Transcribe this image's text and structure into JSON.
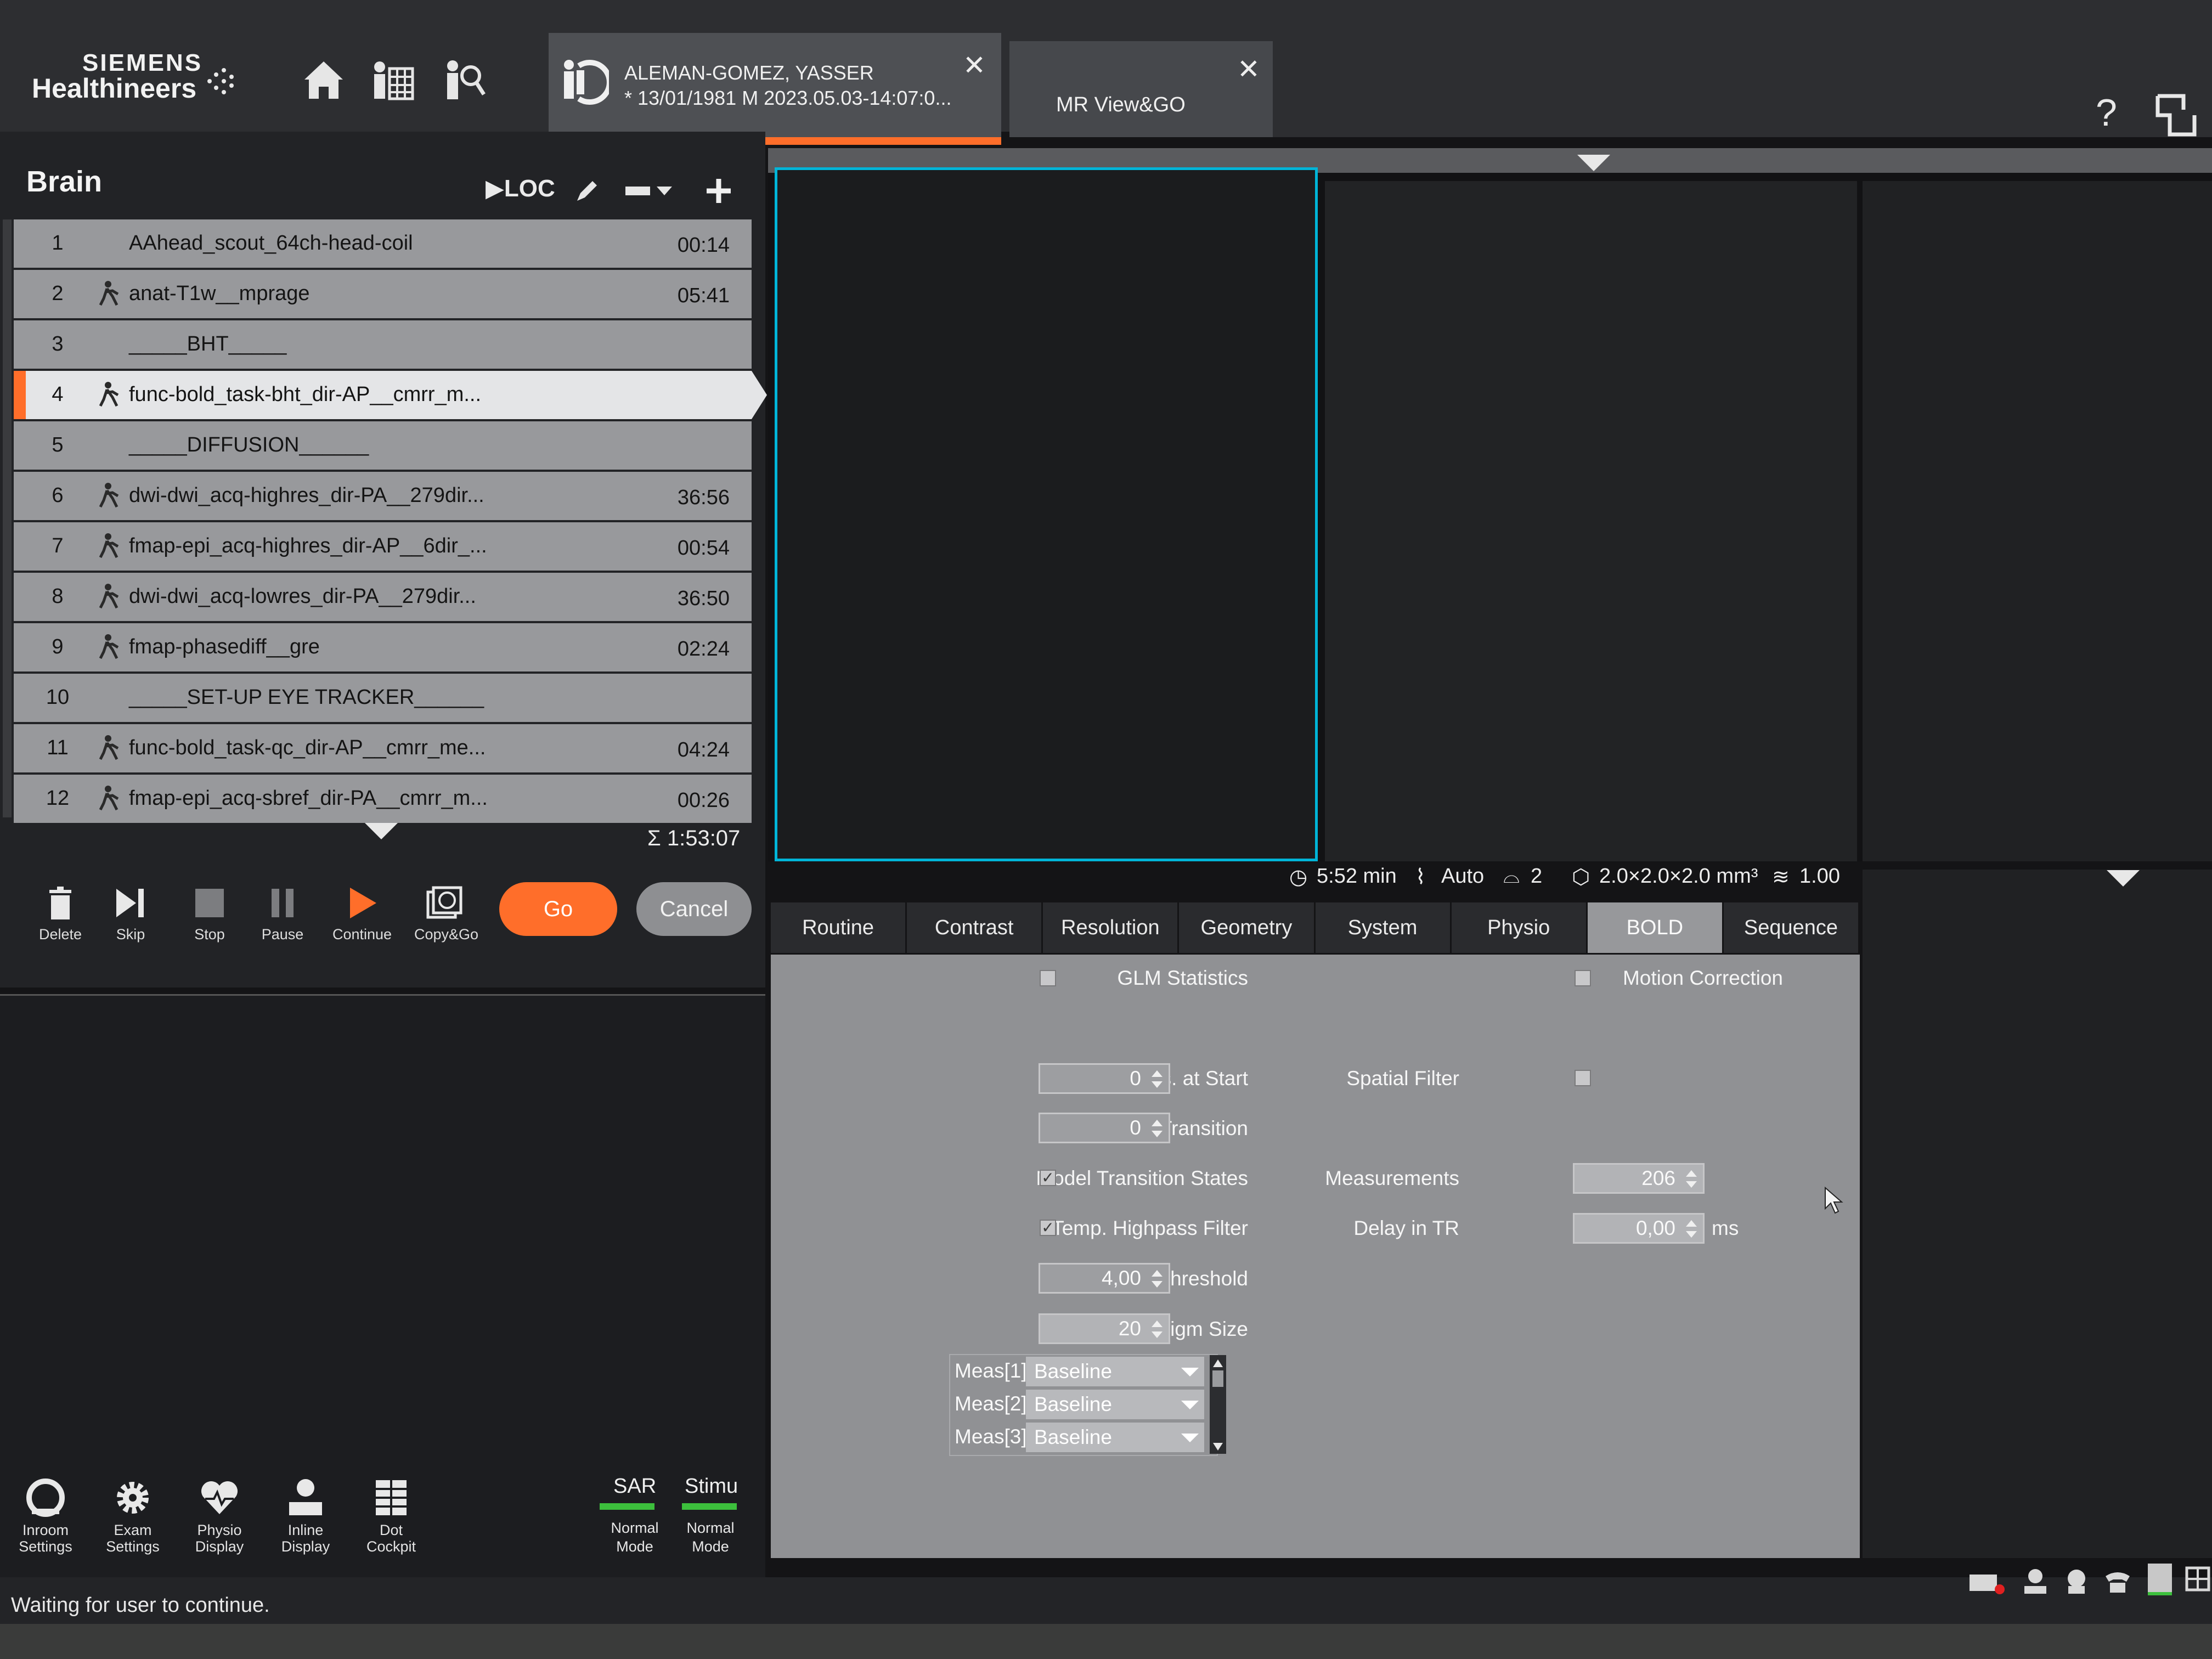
{
  "brand": {
    "line1": "SIEMENS",
    "line2": "Healthineers"
  },
  "nav_icons": [
    "home-icon",
    "patient-schedule-icon",
    "patient-browser-icon"
  ],
  "tabs": {
    "patient": {
      "name": "ALEMAN-GOMEZ, YASSER",
      "details": "* 13/01/1981 M 2023.05.03-14:07:0..."
    },
    "app": {
      "label": "MR View&GO"
    }
  },
  "help_label": "?",
  "program": {
    "title": "Brain",
    "loc_label": "LOC",
    "queue": [
      {
        "num": "1",
        "name": "AAhead_scout_64ch-head-coil",
        "time": "00:14",
        "walker": false
      },
      {
        "num": "2",
        "name": "anat-T1w__mprage",
        "time": "05:41",
        "walker": true
      },
      {
        "num": "3",
        "name": "_____BHT_____",
        "time": "",
        "walker": false
      },
      {
        "num": "4",
        "name": "func-bold_task-bht_dir-AP__cmrr_m...",
        "time": "",
        "walker": true,
        "selected": true
      },
      {
        "num": "5",
        "name": "_____DIFFUSION______",
        "time": "",
        "walker": false
      },
      {
        "num": "6",
        "name": "dwi-dwi_acq-highres_dir-PA__279dir...",
        "time": "36:56",
        "walker": true
      },
      {
        "num": "7",
        "name": "fmap-epi_acq-highres_dir-AP__6dir_...",
        "time": "00:54",
        "walker": true
      },
      {
        "num": "8",
        "name": "dwi-dwi_acq-lowres_dir-PA__279dir...",
        "time": "36:50",
        "walker": true
      },
      {
        "num": "9",
        "name": "fmap-phasediff__gre",
        "time": "02:24",
        "walker": true
      },
      {
        "num": "10",
        "name": "_____SET-UP EYE TRACKER______",
        "time": "",
        "walker": false
      },
      {
        "num": "11",
        "name": "func-bold_task-qc_dir-AP__cmrr_me...",
        "time": "04:24",
        "walker": true
      },
      {
        "num": "12",
        "name": "fmap-epi_acq-sbref_dir-PA__cmrr_m...",
        "time": "00:26",
        "walker": true
      }
    ],
    "total": "Σ 1:53:07"
  },
  "controls": {
    "delete": "Delete",
    "skip": "Skip",
    "stop": "Stop",
    "pause": "Pause",
    "continue": "Continue",
    "copygo": "Copy&Go",
    "go": "Go",
    "cancel": "Cancel"
  },
  "bottom_icons": {
    "inroom": [
      "Inroom",
      "Settings"
    ],
    "exam": [
      "Exam",
      "Settings"
    ],
    "physio": [
      "Physio",
      "Display"
    ],
    "inline": [
      "Inline",
      "Display"
    ],
    "dot": [
      "Dot",
      "Cockpit"
    ]
  },
  "sar": {
    "label": "SAR",
    "mode1": "Normal",
    "mode2": "Mode"
  },
  "stimu": {
    "label": "Stimu",
    "mode1": "Normal",
    "mode2": "Mode"
  },
  "status": "Waiting for user to continue.",
  "infoline": {
    "time": "5:52 min",
    "auto": "Auto",
    "count": "2",
    "voxel": "2.0×2.0×2.0 mm³",
    "accel": "1.00"
  },
  "param_tabs": [
    "Routine",
    "Contrast",
    "Resolution",
    "Geometry",
    "System",
    "Physio",
    "BOLD",
    "Sequence"
  ],
  "active_tab": "BOLD",
  "bold": {
    "glm_statistics": {
      "label": "GLM Statistics",
      "checked": false
    },
    "motion_correction": {
      "label": "Motion Correction",
      "checked": false
    },
    "ignore_meas_start": {
      "label": "Ignore Meas. at Start",
      "value": "0"
    },
    "spatial_filter": {
      "label": "Spatial Filter",
      "checked": false
    },
    "ignore_after_transition": {
      "label": "Ignore After Transition",
      "value": "0"
    },
    "model_transition_states": {
      "label": "Model Transition States",
      "checked": true
    },
    "measurements": {
      "label": "Measurements",
      "value": "206"
    },
    "temp_highpass": {
      "label": "Temp. Highpass Filter",
      "checked": true
    },
    "delay_in_tr": {
      "label": "Delay in TR",
      "value": "0,00",
      "unit": "ms"
    },
    "threshold": {
      "label": "Threshold",
      "value": "4,00"
    },
    "paradigm_size": {
      "label": "Paradigm Size",
      "value": "20"
    },
    "meas_rows": [
      {
        "label": "Meas[1]",
        "value": "Baseline"
      },
      {
        "label": "Meas[2]",
        "value": "Baseline"
      },
      {
        "label": "Meas[3]",
        "value": "Baseline"
      }
    ]
  },
  "colors": {
    "accent": "#ff6e2a",
    "viewer_border": "#00b5d8",
    "sar_bar": "#3cbf3c"
  }
}
